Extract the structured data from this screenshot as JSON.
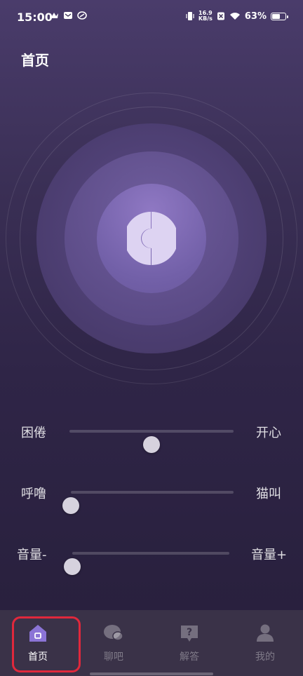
{
  "status_bar": {
    "time": "15:00",
    "net_speed_value": "16.9",
    "net_speed_unit": "KB/s",
    "battery_percent": "63%",
    "battery_level": 0.63
  },
  "header": {
    "title": "首页"
  },
  "sliders": [
    {
      "left_label": "困倦",
      "right_label": "开心",
      "value": 0.5
    },
    {
      "left_label": "呼噜",
      "right_label": "猫叫",
      "value": 0.0
    },
    {
      "left_label": "音量-",
      "right_label": "音量+",
      "value": 0.0
    }
  ],
  "nav": {
    "items": [
      {
        "label": "首页",
        "icon": "home-icon",
        "active": true
      },
      {
        "label": "聊吧",
        "icon": "chat-icon",
        "active": false
      },
      {
        "label": "解答",
        "icon": "question-icon",
        "active": false
      },
      {
        "label": "我的",
        "icon": "user-icon",
        "active": false
      }
    ]
  },
  "colors": {
    "accent": "#8b74d6",
    "highlight": "#e0283c",
    "thumb": "#d6d2de"
  }
}
